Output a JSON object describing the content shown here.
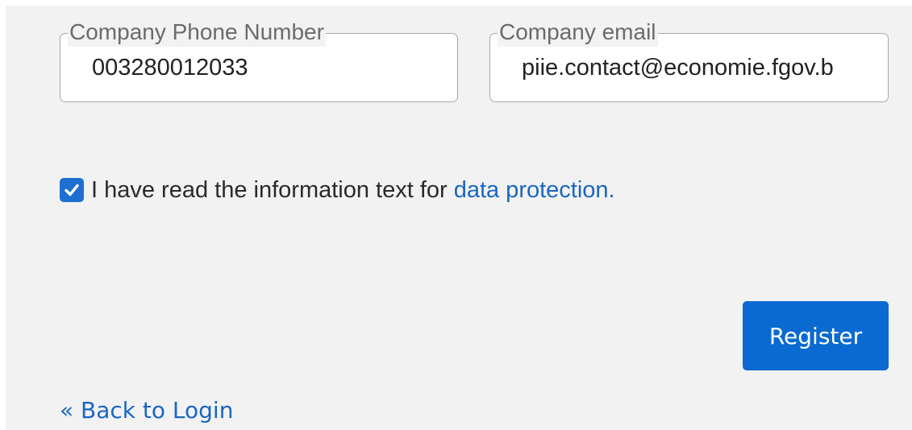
{
  "form": {
    "phone_field": {
      "label": "Company Phone Number",
      "value": "003280012033"
    },
    "email_field": {
      "label": "Company email",
      "value": "piie.contact@economie.fgov.b"
    },
    "consent": {
      "checked": true,
      "text": "I have read the information text for",
      "link_text": "data protection."
    },
    "register_label": "Register",
    "back_link": "« Back to Login"
  },
  "colors": {
    "accent": "#0a6ad1",
    "link": "#1a67c0",
    "background": "#f2f2f2"
  },
  "icons": {
    "checkbox": "checkmark-icon"
  }
}
